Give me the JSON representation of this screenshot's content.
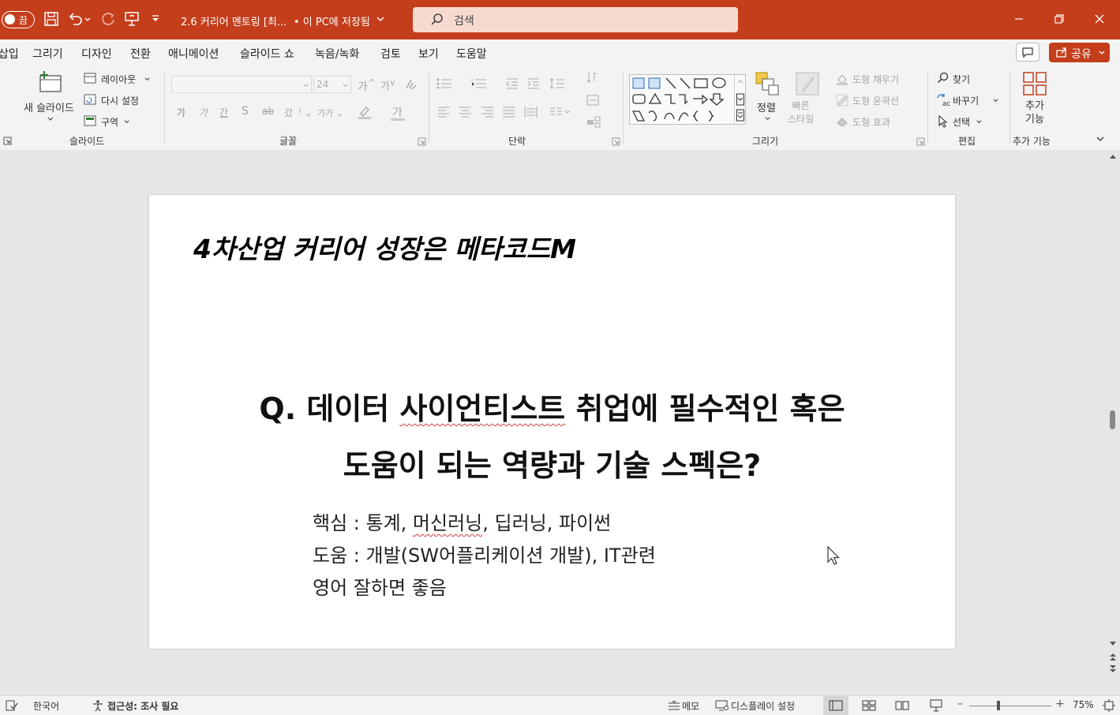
{
  "titlebar": {
    "autosave_label": "끔",
    "document_title": "2.6 커리어 멘토링 [최...",
    "save_status": "• 이 PC에 저장됨",
    "search_placeholder": "검색"
  },
  "menu": {
    "items": [
      "삽입",
      "그리기",
      "디자인",
      "전환",
      "애니메이션",
      "슬라이드 쇼",
      "녹음/녹화",
      "검토",
      "보기",
      "도움말"
    ],
    "share_label": "공유"
  },
  "ribbon": {
    "slides": {
      "new_slide": "새 슬라이드",
      "layout": "레이아웃",
      "reset": "다시 설정",
      "section": "구역",
      "group_label": "슬라이드"
    },
    "font": {
      "font_size": "24",
      "group_label": "글꼴"
    },
    "paragraph": {
      "group_label": "단락"
    },
    "drawing": {
      "arrange": "정렬",
      "quick_styles": "빠른\n스타일",
      "shape_fill": "도형 채우기",
      "shape_outline": "도형 윤곽선",
      "shape_effects": "도형 효과",
      "group_label": "그리기"
    },
    "editing": {
      "find": "찾기",
      "replace": "바꾸기",
      "select": "선택",
      "group_label": "편집"
    },
    "addins": {
      "label": "추가\n기능",
      "group_label": "추가 기능"
    }
  },
  "slide": {
    "header": "4차산업 커리어 성장은 메타코드M",
    "question_line1_a": "Q. 데이터 ",
    "question_line1_b": "사이언티스트",
    "question_line1_c": " 취업에 필수적인 혹은",
    "question_line2": "도움이 되는 역량과 기술 스펙은?",
    "body_line1_a": "핵심 : 통계, ",
    "body_line1_b": "머신러닝",
    "body_line1_c": ", 딥러닝, 파이썬",
    "body_line2": "도움 : 개발(SW어플리케이션 개발), IT관련",
    "body_line3": "영어 잘하면 좋음"
  },
  "statusbar": {
    "language": "한국어",
    "accessibility": "접근성: 조사 필요",
    "notes": "메모",
    "display_settings": "디스플레이 설정",
    "zoom": "75%"
  }
}
